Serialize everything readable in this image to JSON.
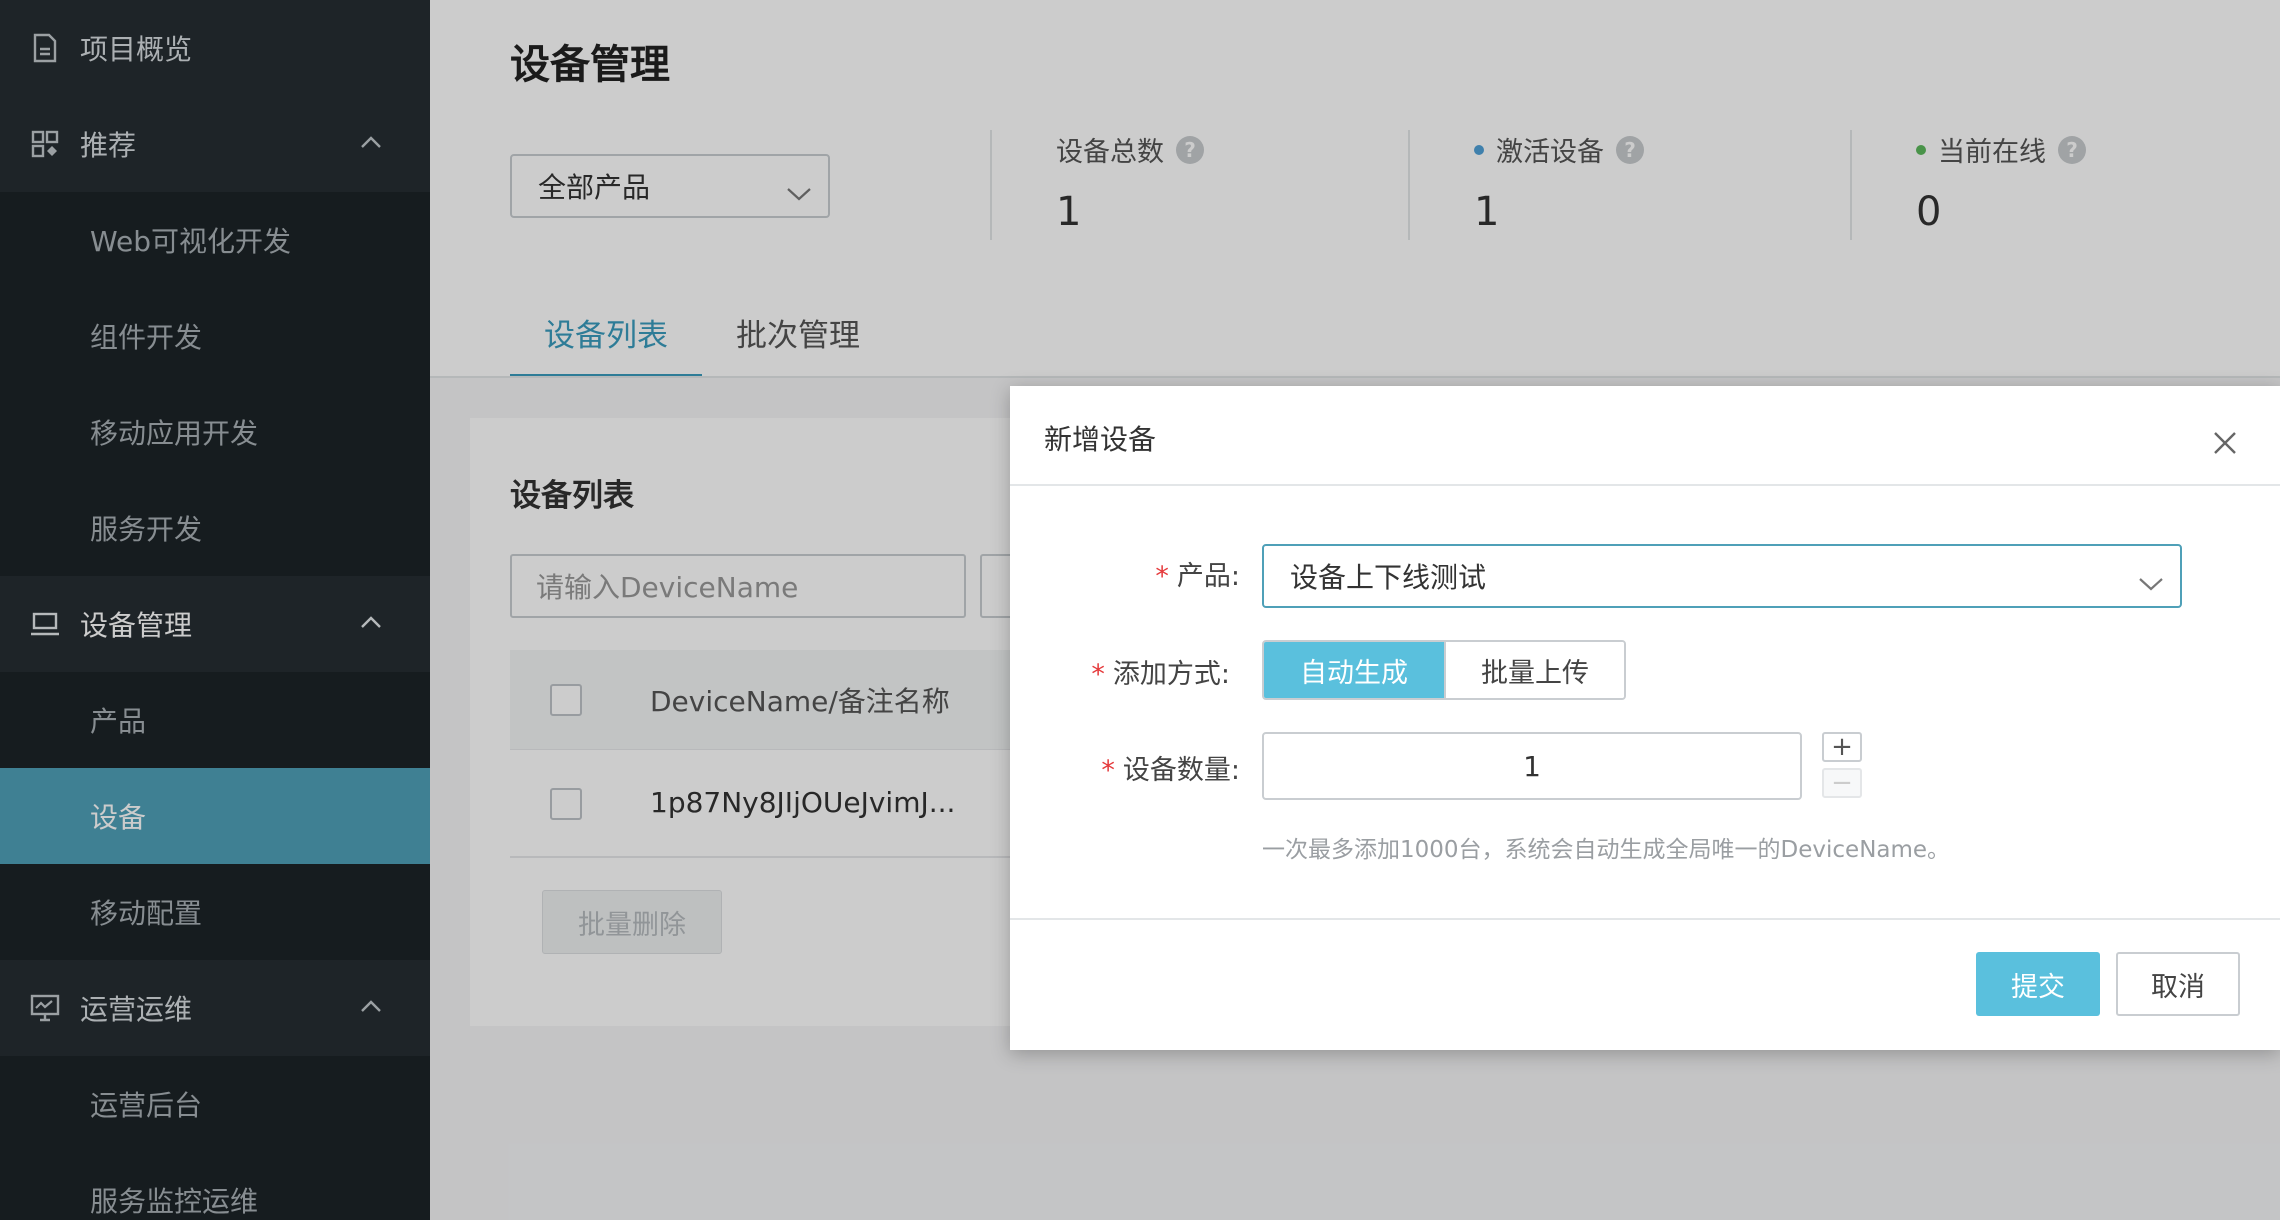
{
  "sidebar": {
    "items": [
      {
        "type": "group",
        "label": "项目概览",
        "icon": "document-icon"
      },
      {
        "type": "group",
        "label": "推荐",
        "icon": "grid-icon",
        "expanded": true
      },
      {
        "type": "sub",
        "label": "Web可视化开发"
      },
      {
        "type": "sub",
        "label": "组件开发"
      },
      {
        "type": "sub",
        "label": "移动应用开发"
      },
      {
        "type": "sub",
        "label": "服务开发"
      },
      {
        "type": "group",
        "label": "设备管理",
        "icon": "laptop-icon",
        "expanded": true
      },
      {
        "type": "sub",
        "label": "产品"
      },
      {
        "type": "sub",
        "label": "设备",
        "active": true
      },
      {
        "type": "sub",
        "label": "移动配置"
      },
      {
        "type": "group",
        "label": "运营运维",
        "icon": "monitor-icon",
        "expanded": true
      },
      {
        "type": "sub",
        "label": "运营后台"
      },
      {
        "type": "sub",
        "label": "服务监控运维"
      }
    ]
  },
  "page": {
    "title": "设备管理",
    "product_filter": "全部产品",
    "stats": [
      {
        "label": "设备总数",
        "value": "1",
        "dot_color": null
      },
      {
        "label": "激活设备",
        "value": "1",
        "dot_color": "#4fa0d8"
      },
      {
        "label": "当前在线",
        "value": "0",
        "dot_color": "#5cb85c"
      }
    ],
    "tabs": [
      {
        "label": "设备列表",
        "active": true
      },
      {
        "label": "批次管理",
        "active": false
      }
    ]
  },
  "device_list": {
    "title": "设备列表",
    "search_placeholder": "请输入DeviceName",
    "column_name": "DeviceName/备注名称",
    "rows": [
      {
        "name": "1p87Ny8JIjOUeJvimJ..."
      }
    ],
    "bulk_delete_label": "批量删除"
  },
  "modal": {
    "title": "新增设备",
    "product_label": "产品:",
    "product_value": "设备上下线测试",
    "method_label": "添加方式:",
    "method_options": [
      "自动生成",
      "批量上传"
    ],
    "method_selected": 0,
    "quantity_label": "设备数量:",
    "quantity_value": "1",
    "stepper_plus": "+",
    "stepper_minus": "−",
    "hint": "一次最多添加1000台，系统会自动生成全局唯一的DeviceName。",
    "submit_label": "提交",
    "cancel_label": "取消",
    "required_mark": "*"
  },
  "colors": {
    "sidebar_bg": "#1c2327",
    "sidebar_active": "#4fa0b8",
    "accent": "#5ac0dd",
    "required": "#e5393b"
  }
}
